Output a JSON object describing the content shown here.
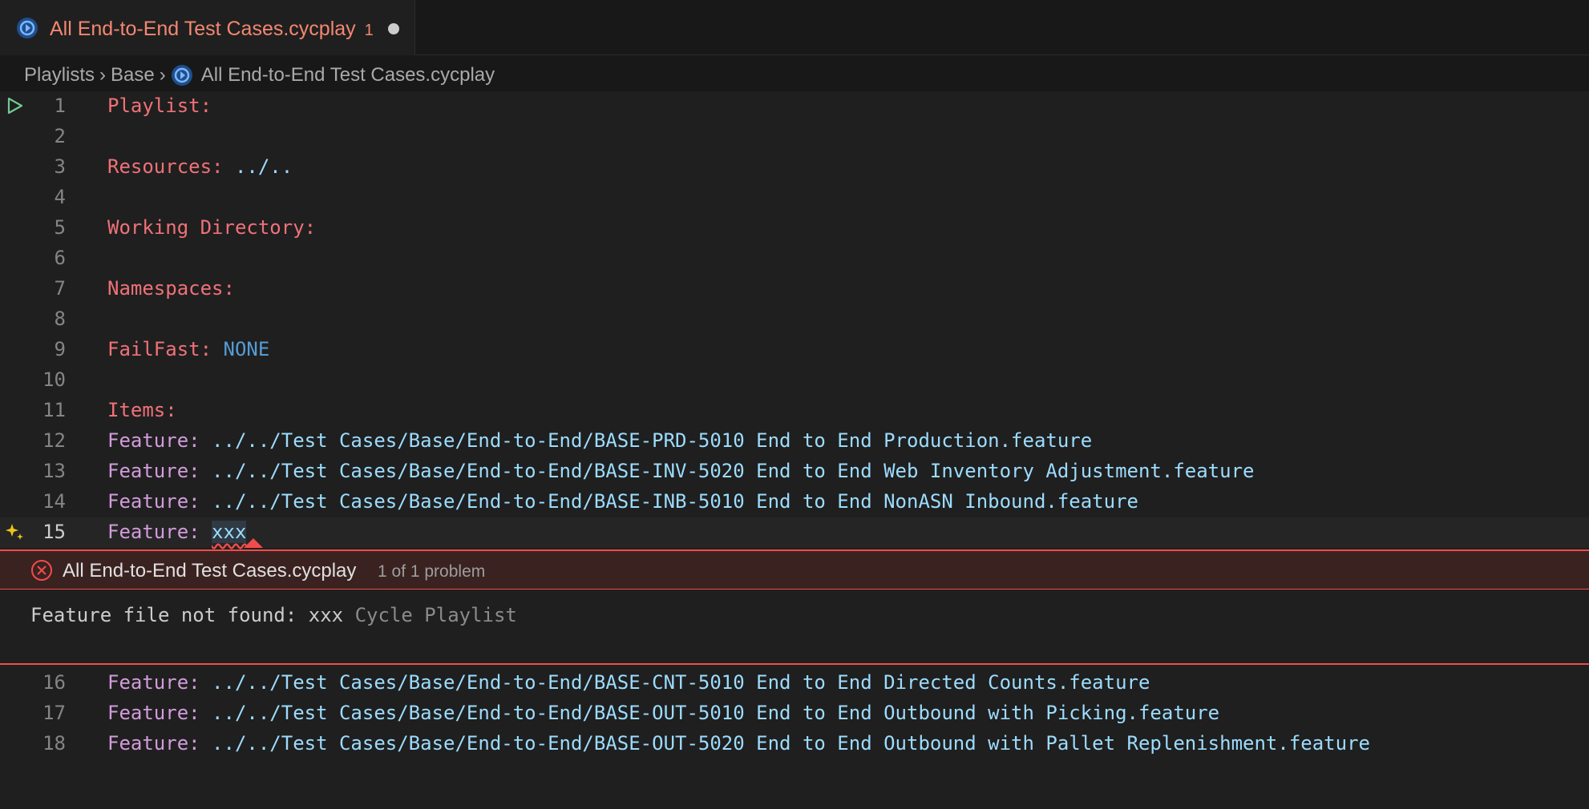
{
  "tab": {
    "title": "All End-to-End Test Cases.cycplay",
    "problem_count": "1",
    "dirty": true
  },
  "breadcrumb": {
    "items": [
      "Playlists",
      "Base",
      "All End-to-End Test Cases.cycplay"
    ]
  },
  "editor": {
    "current_line": 15,
    "lines": [
      {
        "num": "1",
        "key": "Playlist:",
        "value": ""
      },
      {
        "num": "2",
        "key": "",
        "value": ""
      },
      {
        "num": "3",
        "key": "Resources:",
        "value": " ../.."
      },
      {
        "num": "4",
        "key": "",
        "value": ""
      },
      {
        "num": "5",
        "key": "Working Directory:",
        "value": ""
      },
      {
        "num": "6",
        "key": "",
        "value": ""
      },
      {
        "num": "7",
        "key": "Namespaces:",
        "value": ""
      },
      {
        "num": "8",
        "key": "",
        "value": ""
      },
      {
        "num": "9",
        "key": "FailFast:",
        "value": " NONE"
      },
      {
        "num": "10",
        "key": "",
        "value": ""
      },
      {
        "num": "11",
        "key": "Items:",
        "value": ""
      },
      {
        "num": "12",
        "key": "Feature:",
        "value": " ../../Test Cases/Base/End-to-End/BASE-PRD-5010 End to End Production.feature"
      },
      {
        "num": "13",
        "key": "Feature:",
        "value": " ../../Test Cases/Base/End-to-End/BASE-INV-5020 End to End Web Inventory Adjustment.feature"
      },
      {
        "num": "14",
        "key": "Feature:",
        "value": " ../../Test Cases/Base/End-to-End/BASE-INB-5010 End to End NonASN Inbound.feature"
      },
      {
        "num": "15",
        "key": "Feature:",
        "value": "xxx"
      },
      {
        "num": "16",
        "key": "Feature:",
        "value": " ../../Test Cases/Base/End-to-End/BASE-CNT-5010 End to End Directed Counts.feature"
      },
      {
        "num": "17",
        "key": "Feature:",
        "value": " ../../Test Cases/Base/End-to-End/BASE-OUT-5010 End to End Outbound with Picking.feature"
      },
      {
        "num": "18",
        "key": "Feature:",
        "value": " ../../Test Cases/Base/End-to-End/BASE-OUT-5020 End to End Outbound with Pallet Replenishment.feature"
      }
    ]
  },
  "peek": {
    "file": "All End-to-End Test Cases.cycplay",
    "count": "1 of 1 problem",
    "message": "Feature file not found: xxx",
    "source": "Cycle Playlist"
  },
  "colors": {
    "background": "#1f1f1f",
    "keyword": "#f07178",
    "feature_keyword": "#d29cdb",
    "value": "#9cdcfe",
    "error": "#f14c4c"
  },
  "icons": [
    "cycle-playlist-icon",
    "run-icon",
    "sparkle-icon",
    "error-icon",
    "chevron-right-icon"
  ]
}
